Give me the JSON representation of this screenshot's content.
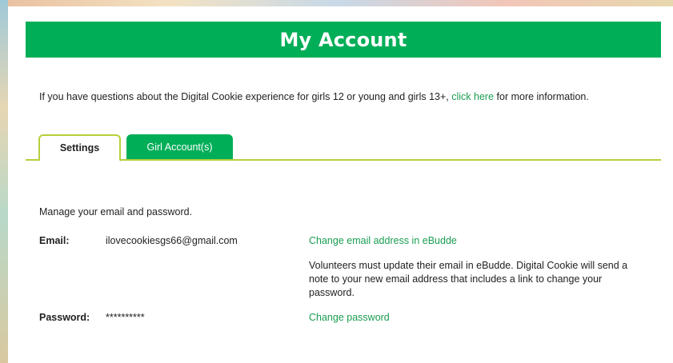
{
  "header": {
    "title": "My Account"
  },
  "intro": {
    "text_before": "If you have questions about the Digital Cookie experience for girls 12 or young and girls 13+, ",
    "link": "click here",
    "text_after": " for more information."
  },
  "tabs": [
    {
      "label": "Settings",
      "active": true
    },
    {
      "label": "Girl Account(s)",
      "active": false
    }
  ],
  "settings": {
    "description": "Manage your email and password.",
    "email_label": "Email:",
    "email_value": "ilovecookiesgs66@gmail.com",
    "email_link": "Change email address in eBudde",
    "email_note": "Volunteers must update their email in eBudde. Digital Cookie will send a note to your new email address that includes a link to change your password.",
    "password_label": "Password:",
    "password_value": "**********",
    "password_link": "Change password"
  },
  "colors": {
    "brand_green": "#00ae58",
    "tab_border": "#b6cf3c",
    "link_green": "#1a9d52"
  }
}
